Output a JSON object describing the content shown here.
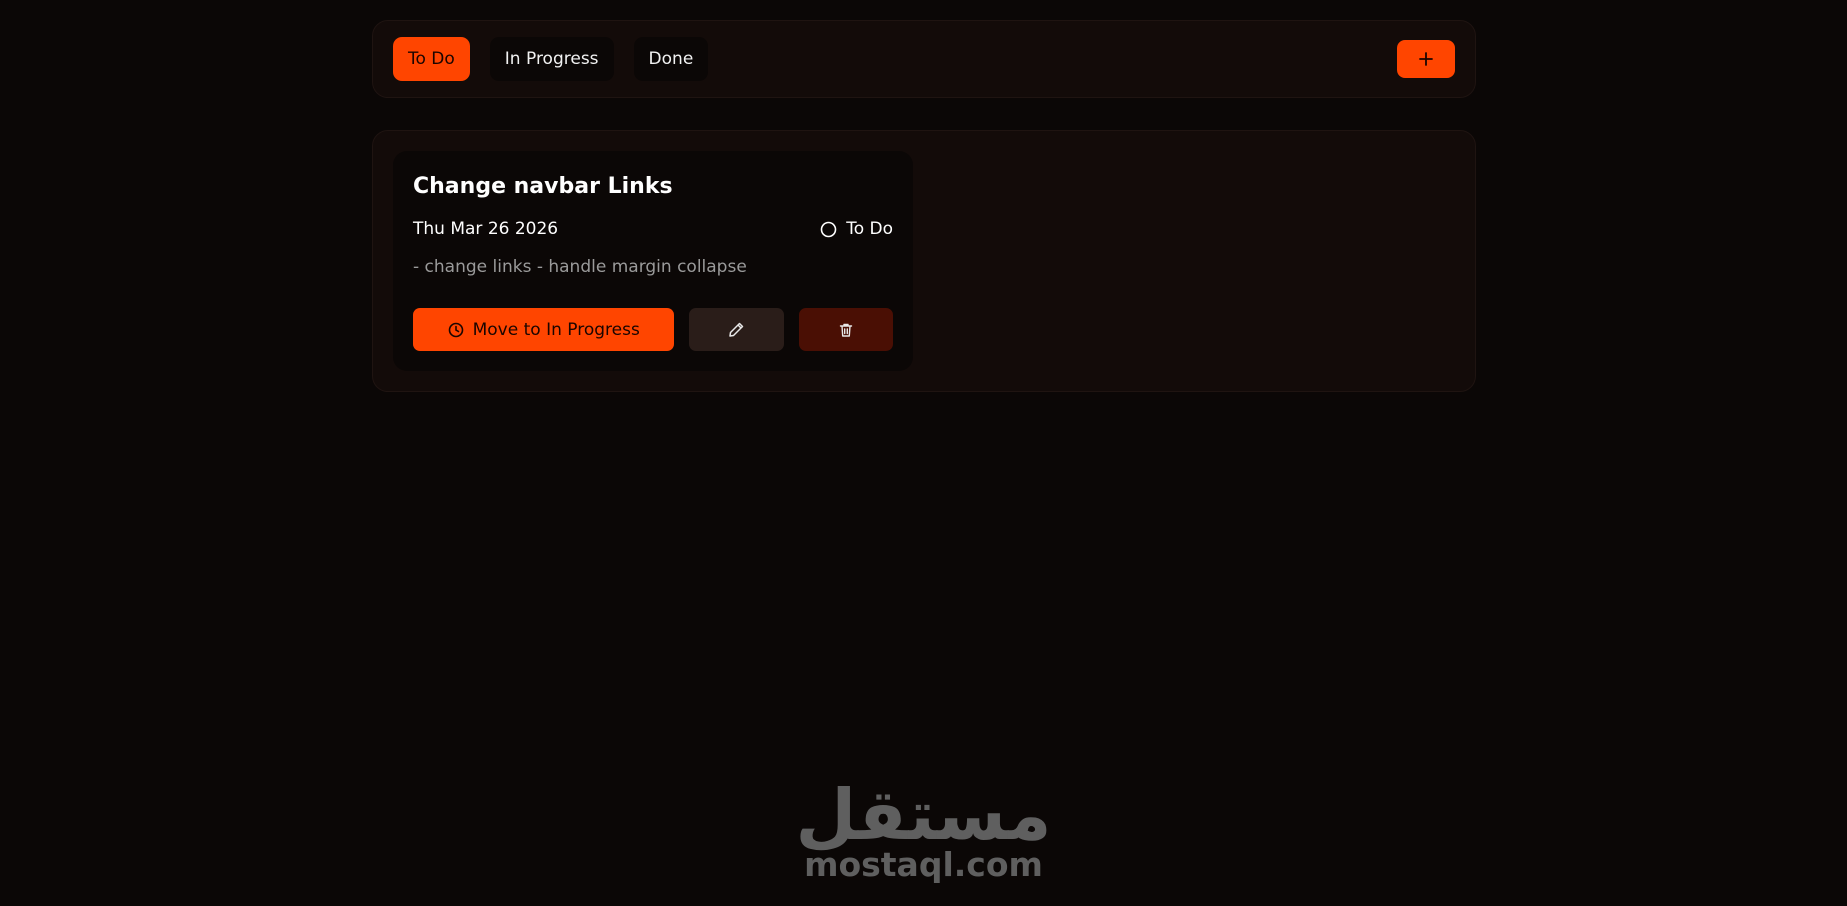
{
  "tabs": [
    {
      "label": "To Do",
      "active": true
    },
    {
      "label": "In Progress",
      "active": false
    },
    {
      "label": "Done",
      "active": false
    }
  ],
  "add_button": {
    "icon": "plus-icon",
    "label": "+"
  },
  "card": {
    "title": "Change navbar Links",
    "date": "Thu Mar 26 2026",
    "status": "To Do",
    "status_icon": "circle-icon",
    "description": "- change links - handle margin collapse",
    "move_label": "Move to In Progress",
    "move_icon": "clock-icon",
    "edit_icon": "pencil-icon",
    "delete_icon": "trash-icon"
  },
  "watermark": {
    "arabic": "مستقل",
    "latin": "mostaql.com"
  },
  "colors": {
    "accent": "#ff4500",
    "background": "#0b0706",
    "panel": "#130b09",
    "edit_bg": "#2a1d19",
    "delete_bg": "#4a0f04"
  }
}
